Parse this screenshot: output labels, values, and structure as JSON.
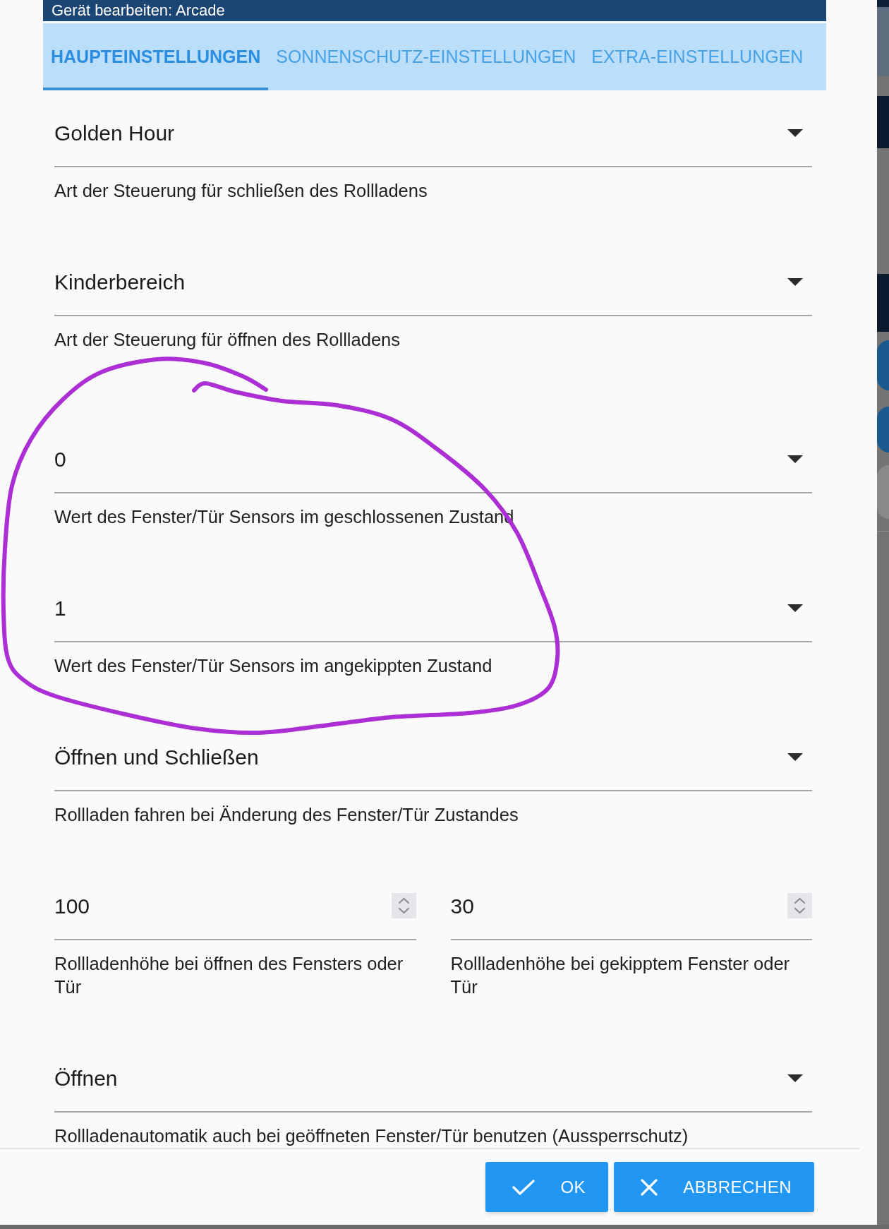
{
  "dialog": {
    "title": "Gerät bearbeiten: Arcade"
  },
  "tabs": [
    {
      "label": "HAUPTEINSTELLUNGEN",
      "selected": true
    },
    {
      "label": "SONNENSCHUTZ-EINSTELLUNGEN",
      "selected": false
    },
    {
      "label": "EXTRA-EINSTELLUNGEN",
      "selected": false
    }
  ],
  "groups": [
    {
      "fields": [
        {
          "kind": "select",
          "value": "Golden Hour",
          "helper": "Art der Steuerung für schließen des Rollladens"
        },
        {
          "kind": "select",
          "value": "Kinderbereich",
          "helper": "Art der Steuerung für öffnen des Rollladens"
        }
      ]
    },
    {
      "fields": [
        {
          "kind": "select",
          "value": "0",
          "helper": "Wert des Fenster/Tür Sensors im geschlossenen Zustand"
        },
        {
          "kind": "select",
          "value": "1",
          "helper": "Wert des Fenster/Tür Sensors im angekippten Zustand"
        },
        {
          "kind": "select",
          "value": "Öffnen und Schließen",
          "helper": "Rollladen fahren bei Änderung des Fenster/Tür Zustandes"
        },
        {
          "kind": "number_pair",
          "items": [
            {
              "value": "100",
              "helper": "Rollladenhöhe bei öffnen des Fensters oder Tür"
            },
            {
              "value": "30",
              "helper": "Rollladenhöhe bei gekipptem Fenster oder Tür"
            }
          ]
        },
        {
          "kind": "select",
          "value": "Öffnen",
          "helper": "Rollladenautomatik auch bei geöffneten Fenster/Tür benutzen (Aussperrschutz)"
        }
      ]
    }
  ],
  "buttons": [
    {
      "kind": "confirm",
      "label": "OK"
    },
    {
      "kind": "cancel",
      "label": "ABBRECHEN"
    }
  ]
}
